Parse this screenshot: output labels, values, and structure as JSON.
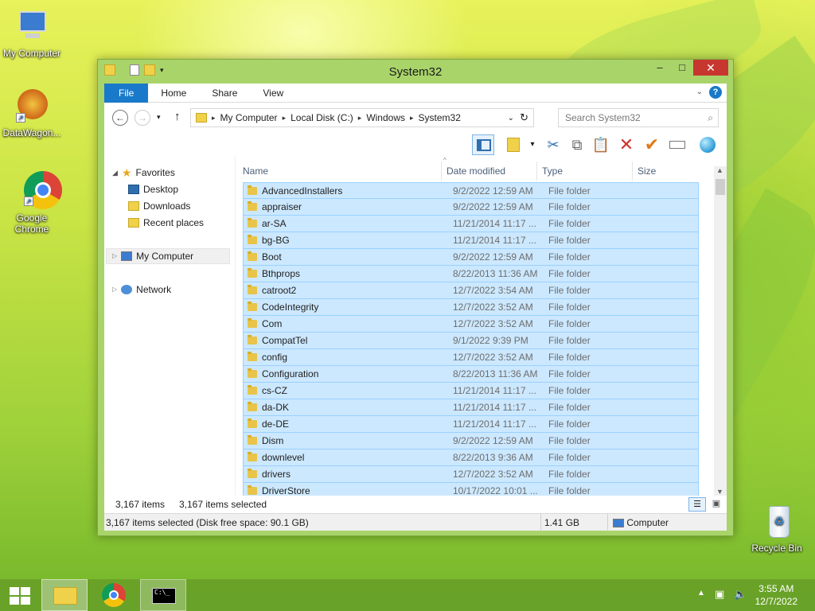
{
  "desktop": {
    "icons": [
      {
        "label": "My Computer"
      },
      {
        "label": "DataWagon..."
      },
      {
        "label": "Google Chrome"
      },
      {
        "label": "Recycle Bin"
      }
    ]
  },
  "window": {
    "title": "System32",
    "ribbon_tabs": [
      "File",
      "Home",
      "Share",
      "View"
    ],
    "address": {
      "segments": [
        "My Computer",
        "Local Disk (C:)",
        "Windows",
        "System32"
      ]
    },
    "search_placeholder": "Search System32",
    "nav": {
      "favorites": "Favorites",
      "desktop": "Desktop",
      "downloads": "Downloads",
      "recent": "Recent places",
      "computer": "My Computer",
      "network": "Network"
    },
    "columns": [
      "Name",
      "Date modified",
      "Type",
      "Size"
    ],
    "rows": [
      {
        "name": "AdvancedInstallers",
        "date": "9/2/2022 12:59 AM",
        "type": "File folder"
      },
      {
        "name": "appraiser",
        "date": "9/2/2022 12:59 AM",
        "type": "File folder"
      },
      {
        "name": "ar-SA",
        "date": "11/21/2014 11:17 ...",
        "type": "File folder"
      },
      {
        "name": "bg-BG",
        "date": "11/21/2014 11:17 ...",
        "type": "File folder"
      },
      {
        "name": "Boot",
        "date": "9/2/2022 12:59 AM",
        "type": "File folder"
      },
      {
        "name": "Bthprops",
        "date": "8/22/2013 11:36 AM",
        "type": "File folder"
      },
      {
        "name": "catroot2",
        "date": "12/7/2022 3:54 AM",
        "type": "File folder"
      },
      {
        "name": "CodeIntegrity",
        "date": "12/7/2022 3:52 AM",
        "type": "File folder"
      },
      {
        "name": "Com",
        "date": "12/7/2022 3:52 AM",
        "type": "File folder"
      },
      {
        "name": "CompatTel",
        "date": "9/1/2022 9:39 PM",
        "type": "File folder"
      },
      {
        "name": "config",
        "date": "12/7/2022 3:52 AM",
        "type": "File folder"
      },
      {
        "name": "Configuration",
        "date": "8/22/2013 11:36 AM",
        "type": "File folder"
      },
      {
        "name": "cs-CZ",
        "date": "11/21/2014 11:17 ...",
        "type": "File folder"
      },
      {
        "name": "da-DK",
        "date": "11/21/2014 11:17 ...",
        "type": "File folder"
      },
      {
        "name": "de-DE",
        "date": "11/21/2014 11:17 ...",
        "type": "File folder"
      },
      {
        "name": "Dism",
        "date": "9/2/2022 12:59 AM",
        "type": "File folder"
      },
      {
        "name": "downlevel",
        "date": "8/22/2013 9:36 AM",
        "type": "File folder"
      },
      {
        "name": "drivers",
        "date": "12/7/2022 3:52 AM",
        "type": "File folder"
      },
      {
        "name": "DriverStore",
        "date": "10/17/2022 10:01 ...",
        "type": "File folder"
      }
    ],
    "status": {
      "items": "3,167 items",
      "selected": "3,167 items selected"
    },
    "infobar": {
      "left": "3,167 items selected (Disk free space: 90.1 GB)",
      "size": "1.41 GB",
      "location": "Computer"
    }
  },
  "taskbar": {
    "time": "3:55 AM",
    "date": "12/7/2022"
  },
  "colors": {
    "selection_fill": "#cce8ff",
    "selection_border": "#99d1ff",
    "accent": "#1979ca",
    "close": "#c7372f"
  }
}
